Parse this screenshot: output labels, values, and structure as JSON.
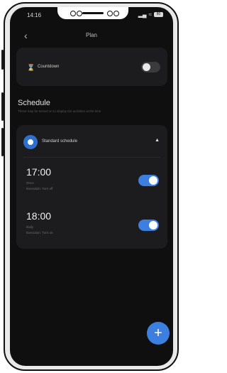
{
  "status_bar": {
    "time": "14:16",
    "signal_icon": "signal-icon",
    "wifi_icon": "wifi-icon",
    "battery": "80"
  },
  "header": {
    "back_icon": "back-arrow-icon",
    "title": "Plan"
  },
  "countdown": {
    "label": "Countdown",
    "enabled": false
  },
  "schedule_section": {
    "title": "Schedule",
    "description": "These may be turned on to display the activities at the time"
  },
  "schedule": {
    "name": "Standard schedule",
    "expanded": true,
    "entries": [
      {
        "time": "17:00",
        "repeat": "Once",
        "action": "Execution: Turn off",
        "enabled": true
      },
      {
        "time": "18:00",
        "repeat": "Daily",
        "action": "Execution: Turn on",
        "enabled": true
      }
    ]
  },
  "colors": {
    "accent": "#3d7fe0",
    "background": "#0f0f10",
    "card": "#1c1c1e"
  },
  "fab": {
    "icon": "plus-icon",
    "label": "+"
  }
}
